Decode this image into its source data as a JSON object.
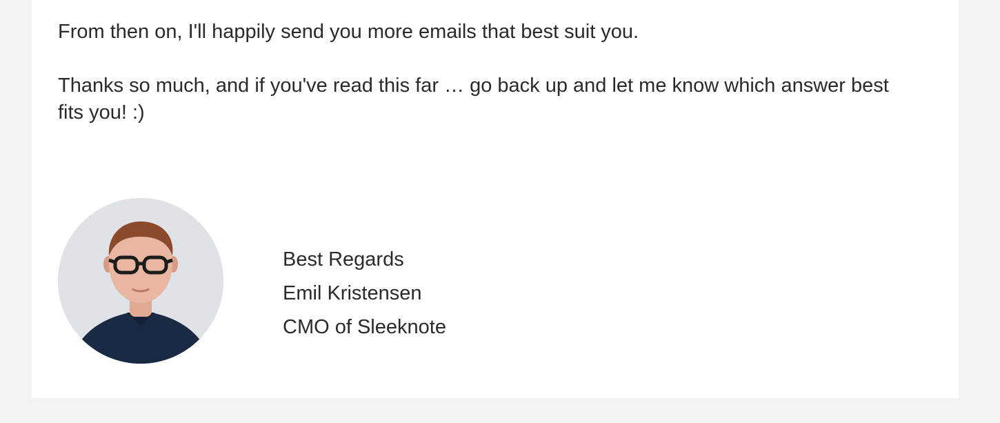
{
  "email": {
    "paragraphs": [
      "From then on, I'll happily send you more emails that best suit you.",
      "Thanks so much, and if you've read this far … go back up and let me know which answer best fits you! :)"
    ],
    "signature": {
      "greeting": "Best Regards",
      "name": "Emil Kristensen",
      "title": "CMO of Sleeknote"
    }
  },
  "colors": {
    "page_background": "#f2f3f6",
    "card_background": "#ffffff",
    "text": "#2a2a2a",
    "avatar_background": "#dfe3e7",
    "shirt": "#1b2a44"
  },
  "icons": {
    "avatar": "person-photo"
  }
}
